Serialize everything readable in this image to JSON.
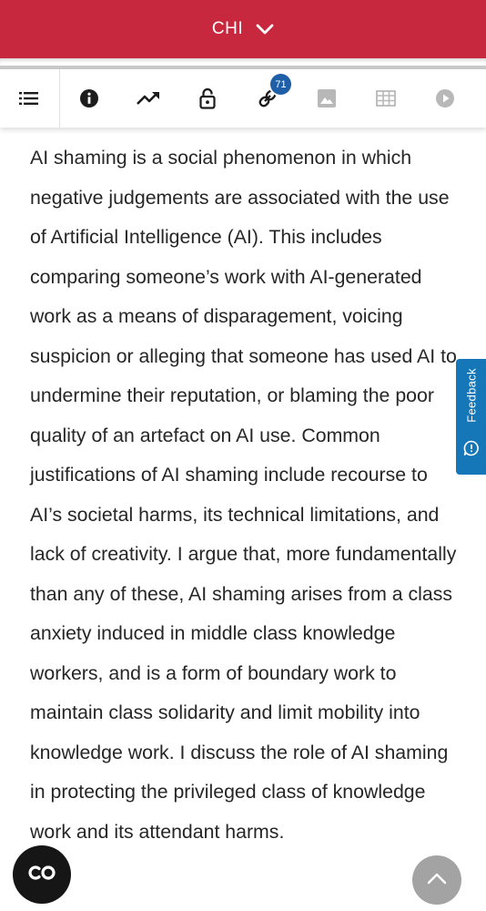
{
  "header": {
    "venue_label": "CHI"
  },
  "toolbar": {
    "items": [
      {
        "name": "table-of-contents",
        "icon": "list-icon",
        "active": true
      },
      {
        "name": "information",
        "icon": "info-icon",
        "active": true
      },
      {
        "name": "metrics",
        "icon": "trending-up-icon",
        "active": true
      },
      {
        "name": "access",
        "icon": "lock-icon",
        "active": true
      },
      {
        "name": "references",
        "icon": "link-icon",
        "active": true,
        "badge": "71"
      },
      {
        "name": "figures",
        "icon": "image-icon",
        "active": false
      },
      {
        "name": "tables",
        "icon": "table-icon",
        "active": false
      },
      {
        "name": "media",
        "icon": "play-icon",
        "active": false
      }
    ],
    "colors": {
      "active": "#1c1c1c",
      "inactive": "#b8b8b8",
      "badge": "#1f5fa8"
    }
  },
  "abstract": {
    "text": "AI shaming is a social phenomenon in which negative judgements are associated with the use of Artificial Intelligence (AI). This includes comparing someone’s work with AI-generated work as a means of disparagement, voicing suspicion or alleging that someone has used AI to undermine their reputation, or blaming the poor quality of an artefact on AI use. Common justifications of AI shaming include recourse to AI’s societal harms, its technical limitations, and lack of creativity. I argue that, more fundamentally than any of these, AI shaming arises from a class anxiety induced in middle class knowledge workers, and is a form of boundary work to maintain class solidarity and limit mobility into knowledge work. I discuss the role of AI shaming in protecting the privileged class of knowledge work and its attendant harms."
  },
  "feedback": {
    "label": "Feedback",
    "color": "#1577b8"
  },
  "floating": {
    "cc_icon": "closed-captions-icon",
    "scroll_icon": "chevron-up-icon"
  },
  "theme": {
    "header_color": "#c8283e"
  }
}
